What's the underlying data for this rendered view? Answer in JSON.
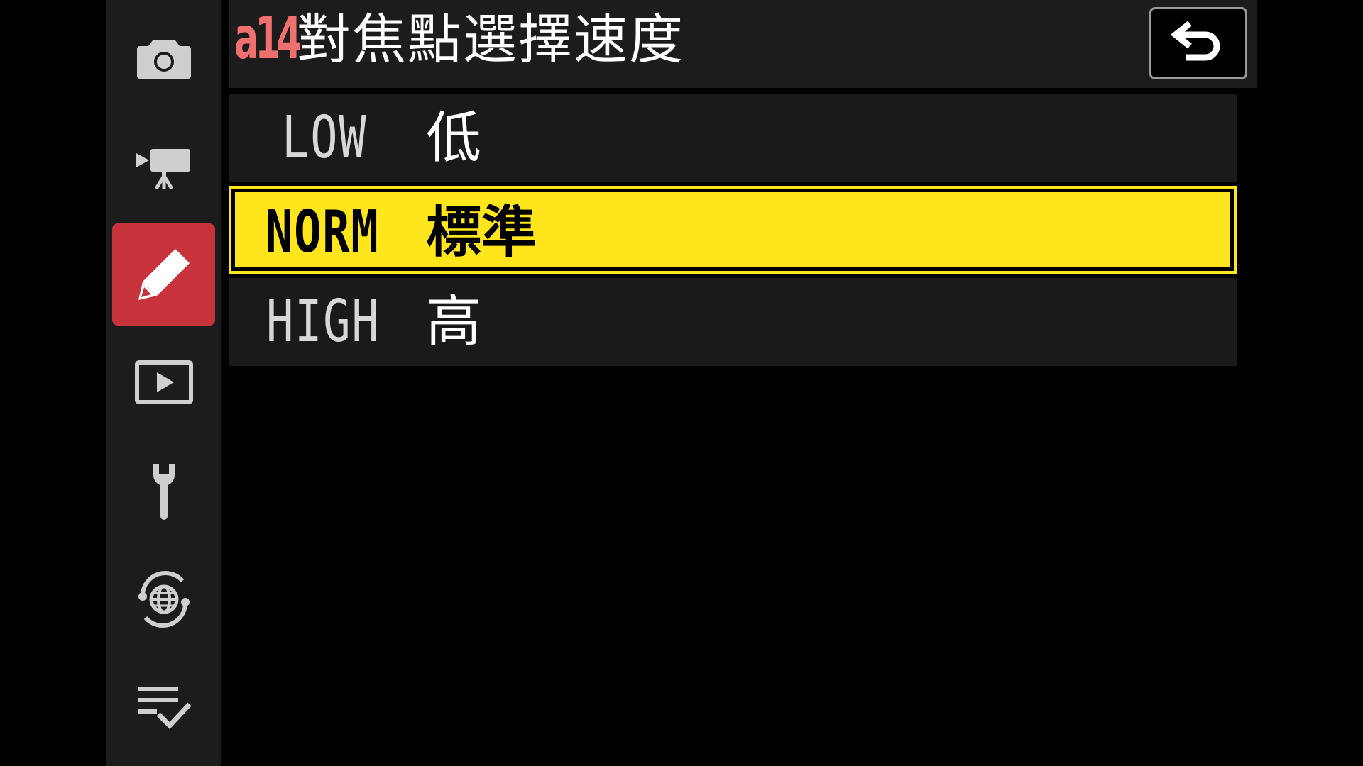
{
  "header": {
    "menu_code": "a14",
    "title": "對焦點選擇速度",
    "back_icon": "back-arrow-icon"
  },
  "sidebar": {
    "items": [
      {
        "icon": "camera-icon",
        "active": false
      },
      {
        "icon": "movie-camera-icon",
        "active": false
      },
      {
        "icon": "pencil-icon",
        "active": true
      },
      {
        "icon": "playback-icon",
        "active": false
      },
      {
        "icon": "wrench-icon",
        "active": false
      },
      {
        "icon": "network-icon",
        "active": false
      },
      {
        "icon": "my-menu-icon",
        "active": false
      }
    ]
  },
  "options": [
    {
      "code": "LOW",
      "label": "低",
      "selected": false
    },
    {
      "code": "NORM",
      "label": "標準",
      "selected": true
    },
    {
      "code": "HIGH",
      "label": "高",
      "selected": false
    }
  ],
  "colors": {
    "accent_red": "#c8323a",
    "selection_yellow": "#fee51c",
    "code_red": "#f07070"
  }
}
